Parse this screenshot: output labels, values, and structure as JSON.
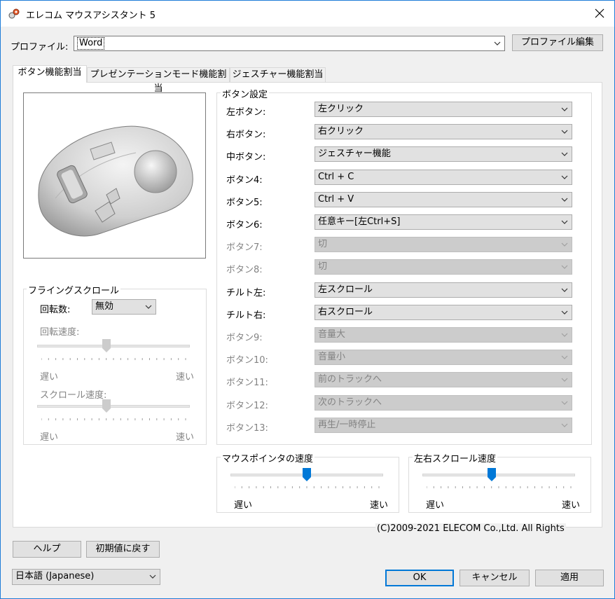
{
  "window": {
    "title": "エレコム マウスアシスタント 5",
    "close_label": "✕"
  },
  "profile": {
    "label": "プロファイル:",
    "value": "Word",
    "edit_button": "プロファイル編集"
  },
  "tabs": [
    {
      "label": "ボタン機能割当"
    },
    {
      "label": "プレゼンテーションモード機能割当"
    },
    {
      "label": "ジェスチャー機能割当"
    }
  ],
  "flying_scroll": {
    "title": "フライングスクロール",
    "rotation_label": "回転数:",
    "rotation_value": "無効",
    "rotation_speed_label": "回転速度:",
    "scroll_speed_label": "スクロール速度:",
    "slow": "遅い",
    "fast": "速い",
    "rotation_speed_level": 0.45,
    "scroll_speed_level": 0.45
  },
  "button_settings": {
    "title": "ボタン設定",
    "rows": [
      {
        "label": "左ボタン:",
        "value": "左クリック",
        "enabled": true
      },
      {
        "label": "右ボタン:",
        "value": "右クリック",
        "enabled": true
      },
      {
        "label": "中ボタン:",
        "value": "ジェスチャー機能",
        "enabled": true
      },
      {
        "label": "ボタン4:",
        "value": "Ctrl + C",
        "enabled": true
      },
      {
        "label": "ボタン5:",
        "value": "Ctrl + V",
        "enabled": true
      },
      {
        "label": "ボタン6:",
        "value": "任意キー[左Ctrl+S]",
        "enabled": true
      },
      {
        "label": "ボタン7:",
        "value": "切",
        "enabled": false
      },
      {
        "label": "ボタン8:",
        "value": "切",
        "enabled": false
      },
      {
        "label": "チルト左:",
        "value": "左スクロール",
        "enabled": true
      },
      {
        "label": "チルト右:",
        "value": "右スクロール",
        "enabled": true
      },
      {
        "label": "ボタン9:",
        "value": "音量大",
        "enabled": false
      },
      {
        "label": "ボタン10:",
        "value": "音量小",
        "enabled": false
      },
      {
        "label": "ボタン11:",
        "value": "前のトラックへ",
        "enabled": false
      },
      {
        "label": "ボタン12:",
        "value": "次のトラックへ",
        "enabled": false
      },
      {
        "label": "ボタン13:",
        "value": "再生/一時停止",
        "enabled": false
      }
    ]
  },
  "pointer_speed": {
    "title": "マウスポインタの速度",
    "slow": "遅い",
    "fast": "速い",
    "level": 0.5
  },
  "lr_scroll_speed": {
    "title": "左右スクロール速度",
    "slow": "遅い",
    "fast": "速い",
    "level": 0.45
  },
  "copyright": "(C)2009-2021  ELECOM Co.,Ltd. All Rights",
  "footer": {
    "help": "ヘルプ",
    "reset": "初期値に戻す",
    "language": "日本語 (Japanese)",
    "ok": "OK",
    "cancel": "キャンセル",
    "apply": "適用"
  },
  "colors": {
    "accent": "#0078d7",
    "disabled_text": "#838383",
    "disabled_bg": "#cccccc"
  }
}
